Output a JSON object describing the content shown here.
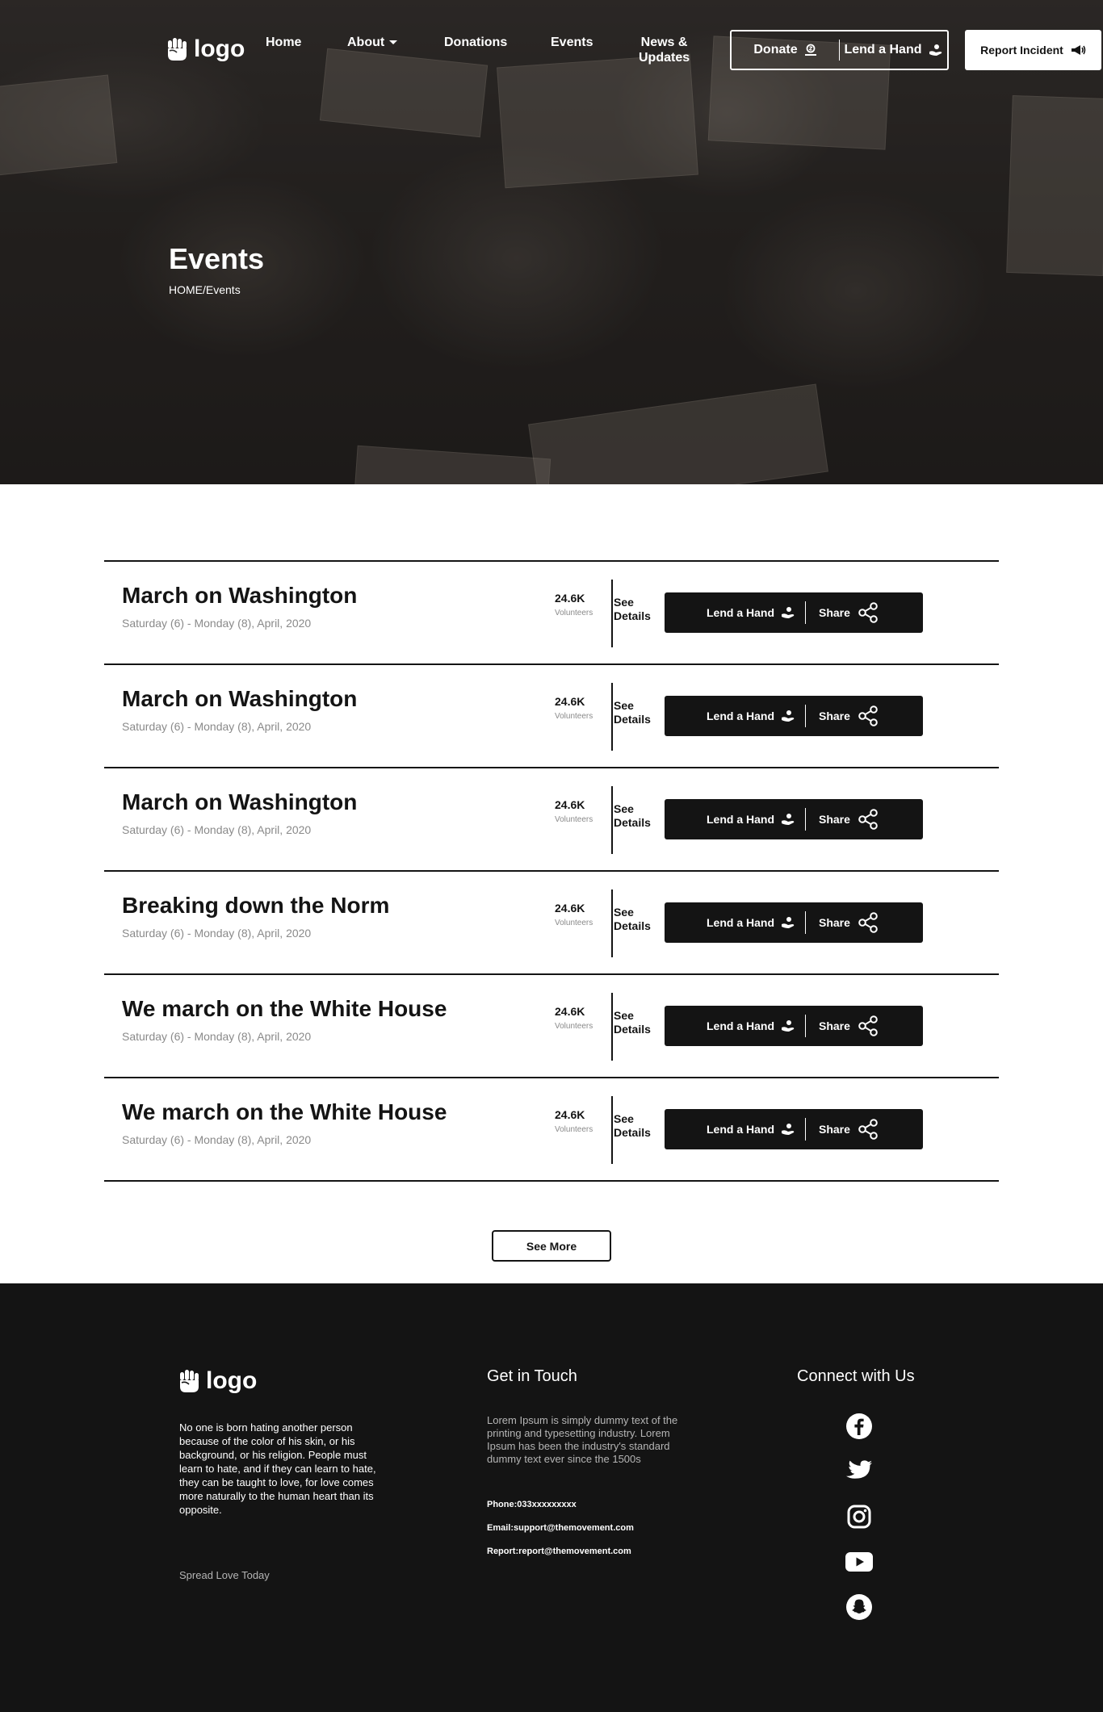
{
  "nav": {
    "logo_text": "logo",
    "links": [
      "Home",
      "About",
      "Donations",
      "Events",
      "News &",
      "Updates"
    ],
    "donate_label": "Donate",
    "lend_label": "Lend a Hand",
    "report_label": "Report Incident"
  },
  "hero": {
    "title": "Events",
    "breadcrumb": "HOME/Events"
  },
  "events": [
    {
      "title": "March on Washington",
      "date": "Saturday (6) - Monday (8), April, 2020",
      "volunteers": "24.6K",
      "volunteers_label": "Volunteers",
      "details_label": "See Details",
      "lend_label": "Lend a Hand",
      "share_label": "Share"
    },
    {
      "title": "March on Washington",
      "date": "Saturday (6) - Monday (8), April, 2020",
      "volunteers": "24.6K",
      "volunteers_label": "Volunteers",
      "details_label": "See Details",
      "lend_label": "Lend a Hand",
      "share_label": "Share"
    },
    {
      "title": "March on Washington",
      "date": "Saturday (6) - Monday (8), April, 2020",
      "volunteers": "24.6K",
      "volunteers_label": "Volunteers",
      "details_label": "See Details",
      "lend_label": "Lend a Hand",
      "share_label": "Share"
    },
    {
      "title": "Breaking down the Norm",
      "date": "Saturday (6) - Monday (8), April, 2020",
      "volunteers": "24.6K",
      "volunteers_label": "Volunteers",
      "details_label": "See Details",
      "lend_label": "Lend a Hand",
      "share_label": "Share"
    },
    {
      "title": "We march on the White House",
      "date": "Saturday (6) - Monday (8), April, 2020",
      "volunteers": "24.6K",
      "volunteers_label": "Volunteers",
      "details_label": "See Details",
      "lend_label": "Lend a Hand",
      "share_label": "Share"
    },
    {
      "title": "We march on the White House",
      "date": "Saturday (6) - Monday (8), April, 2020",
      "volunteers": "24.6K",
      "volunteers_label": "Volunteers",
      "details_label": "See Details",
      "lend_label": "Lend a Hand",
      "share_label": "Share"
    }
  ],
  "see_more_label": "See More",
  "footer": {
    "logo_text": "logo",
    "quote": "No one is born hating another person because of the color of his skin, or his background, or his religion. People must learn to hate, and if they can learn to hate, they can be taught to love, for love comes more naturally to the human heart than its opposite.",
    "tagline": "Spread Love Today",
    "get_in_touch_title": "Get in Touch",
    "lorem": "Lorem Ipsum is simply dummy text of the printing and typesetting industry. Lorem Ipsum has been the industry's standard dummy text ever since the 1500s",
    "phone": "Phone:033xxxxxxxxx",
    "email": "Email:support@themovement.com",
    "report": "Report:report@themovement.com",
    "connect_title": "Connect with Us",
    "social_icons": [
      "facebook-icon",
      "twitter-icon",
      "instagram-icon",
      "youtube-icon",
      "snapchat-icon"
    ]
  }
}
